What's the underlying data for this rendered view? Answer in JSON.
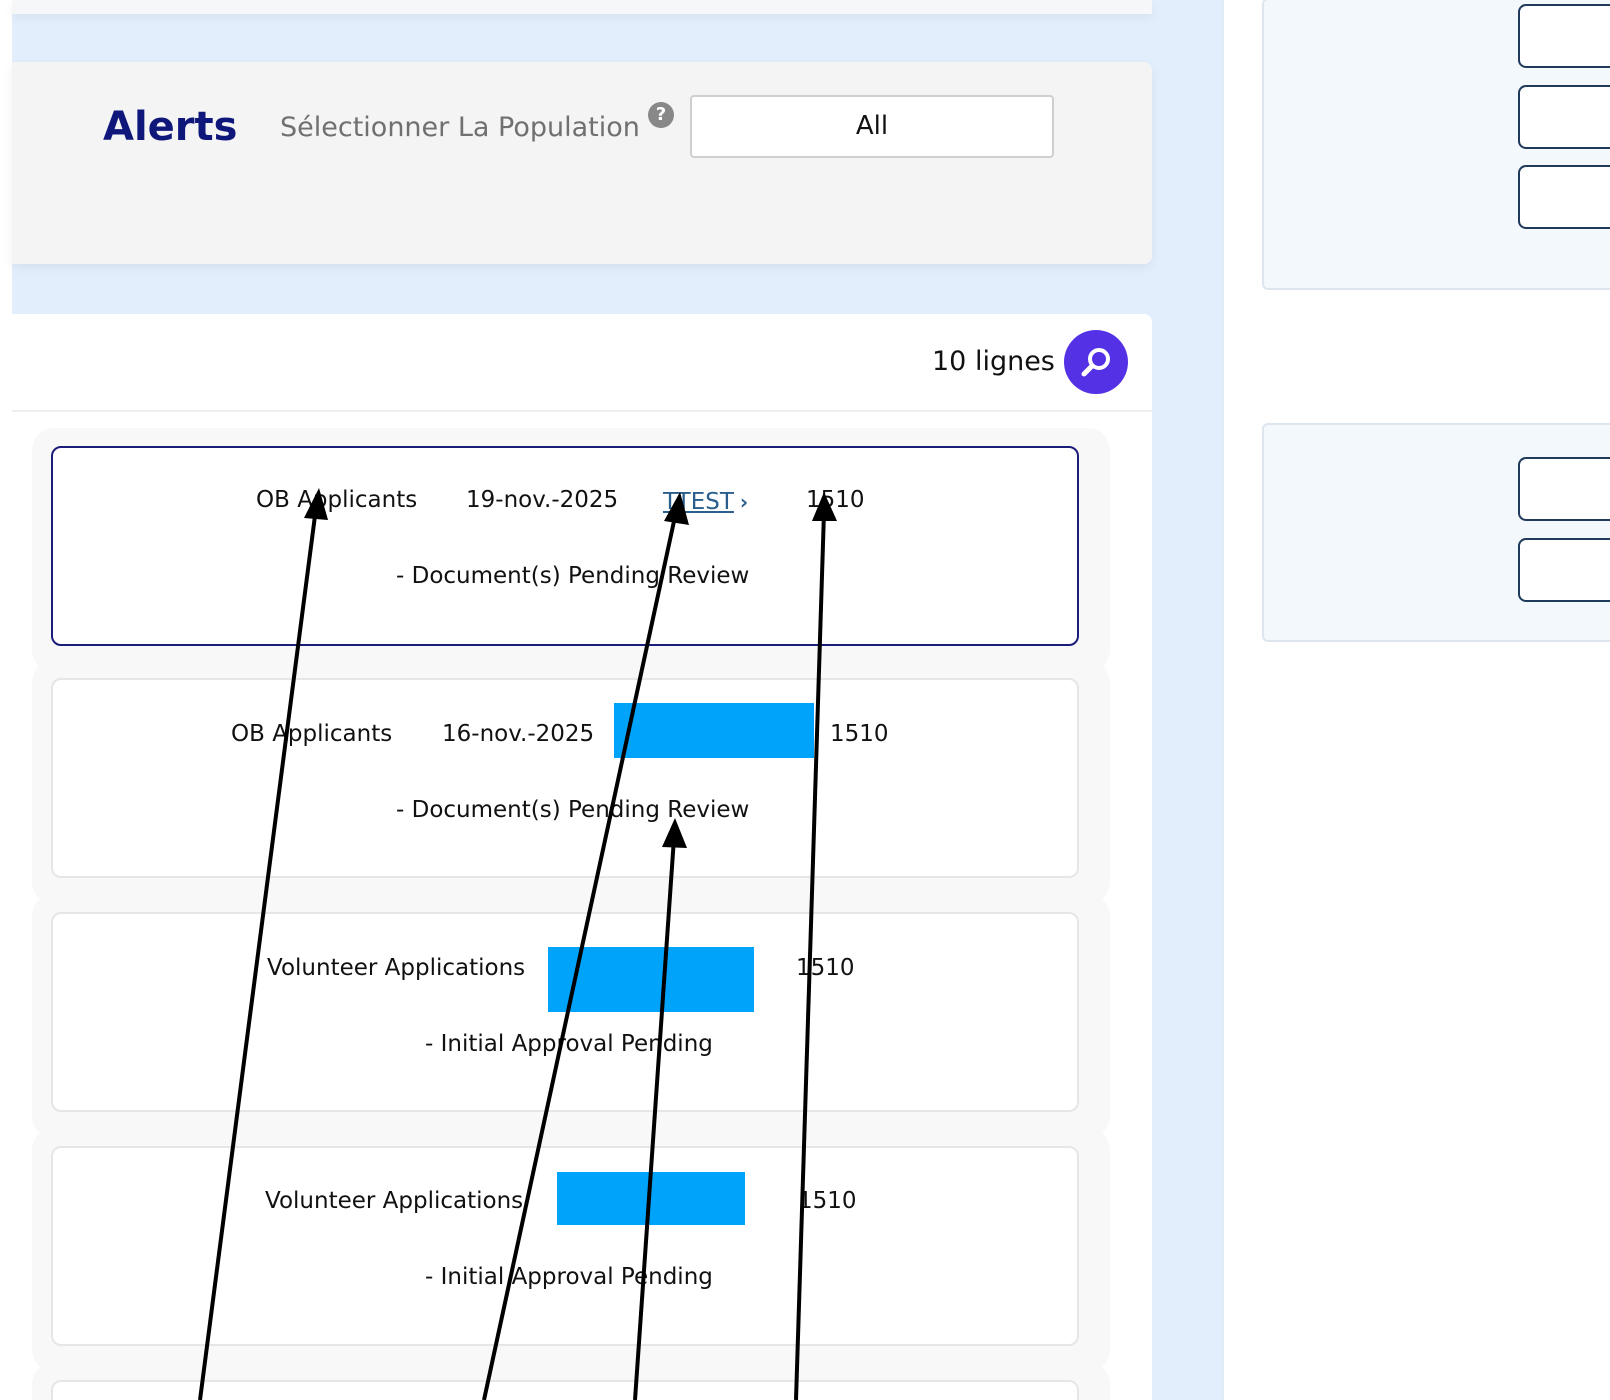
{
  "header": {
    "title": "Alerts",
    "population_label": "Sélectionner La Population",
    "population_value": "All",
    "help_icon": "?"
  },
  "list": {
    "rows_label": "10 lignes",
    "search_icon": "magnifier-icon",
    "cards": [
      {
        "category": "OB Applicants",
        "date": "19-nov.-2025",
        "user": "TTEST",
        "id": "1510",
        "detail": "- Document(s) Pending Review"
      },
      {
        "category": "OB Applicants",
        "date": "16-nov.-2025",
        "id": "1510",
        "detail": "- Document(s) Pending Review"
      },
      {
        "category": "Volunteer Applications",
        "id": "1510",
        "detail": "- Initial Approval Pending"
      },
      {
        "category": "Volunteer Applications",
        "id": "1510",
        "detail": "- Initial Approval Pending"
      }
    ]
  },
  "colors": {
    "accent": "#5531e6",
    "title": "#10177a",
    "redaction": "#00a3fa",
    "selected_border": "#1a1d7a"
  }
}
